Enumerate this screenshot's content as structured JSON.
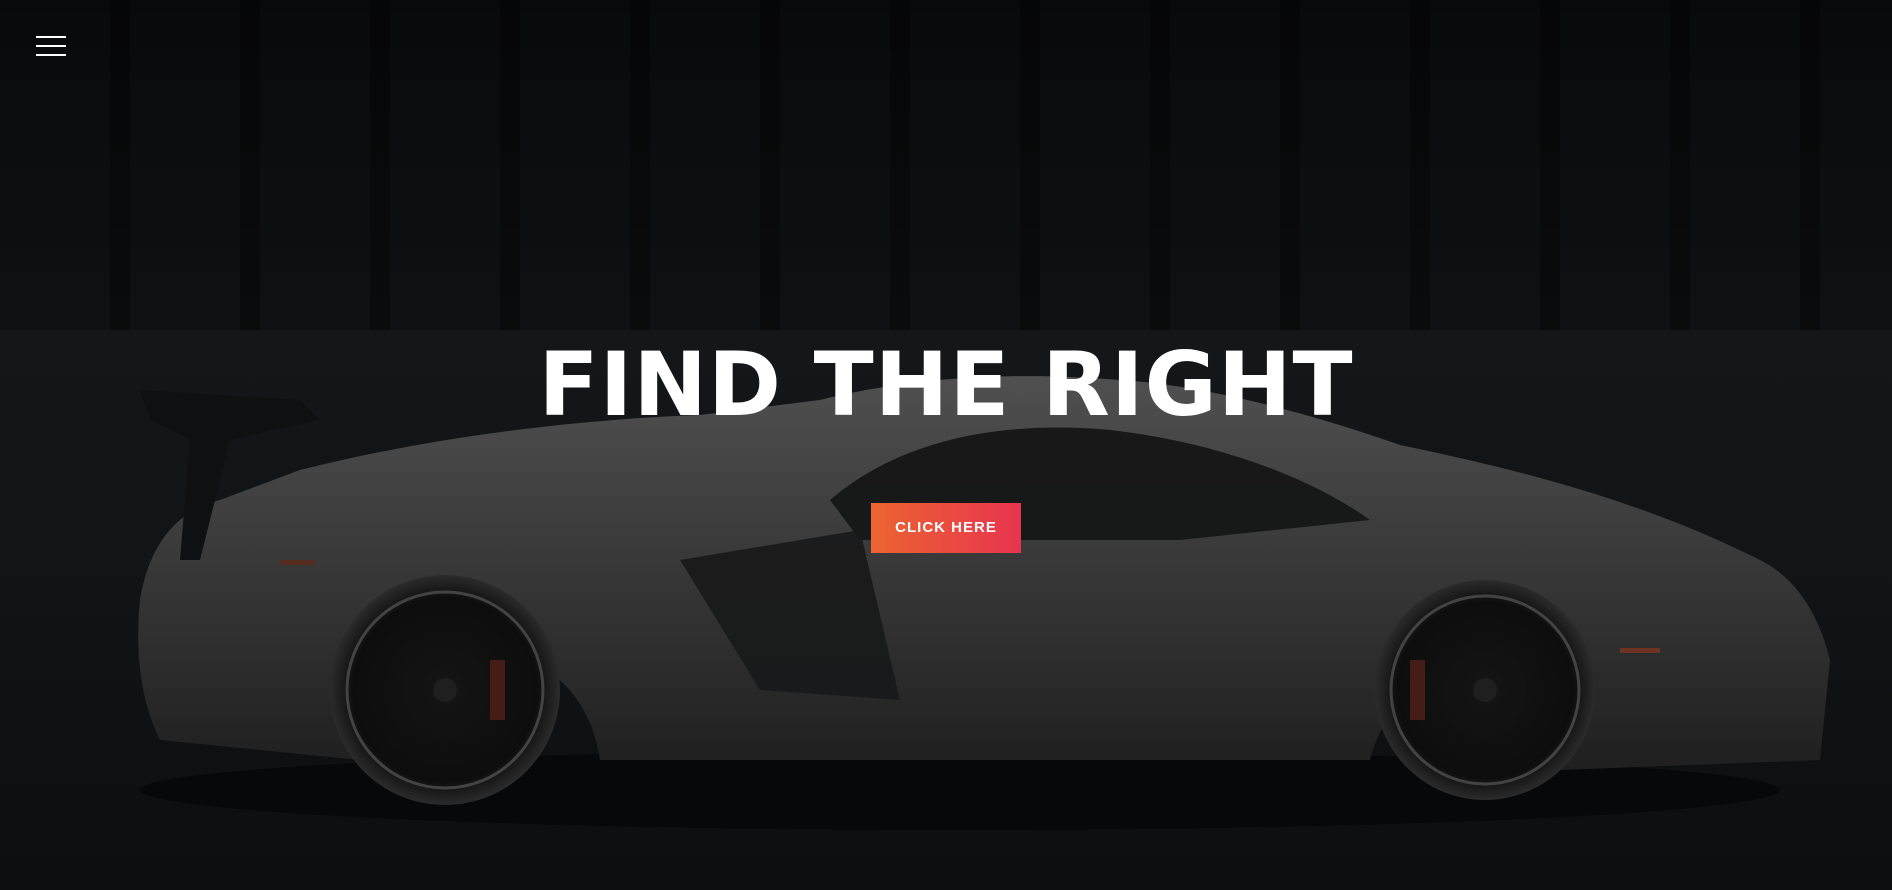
{
  "hero": {
    "title": "FIND THE RIGHT",
    "cta_label": "CLICK HERE",
    "menu_icon": "hamburger-menu-icon",
    "background_image": "silver-sports-car",
    "accent_gradient": [
      "#ec6431",
      "#e8344f"
    ],
    "text_color": "#ffffff"
  }
}
